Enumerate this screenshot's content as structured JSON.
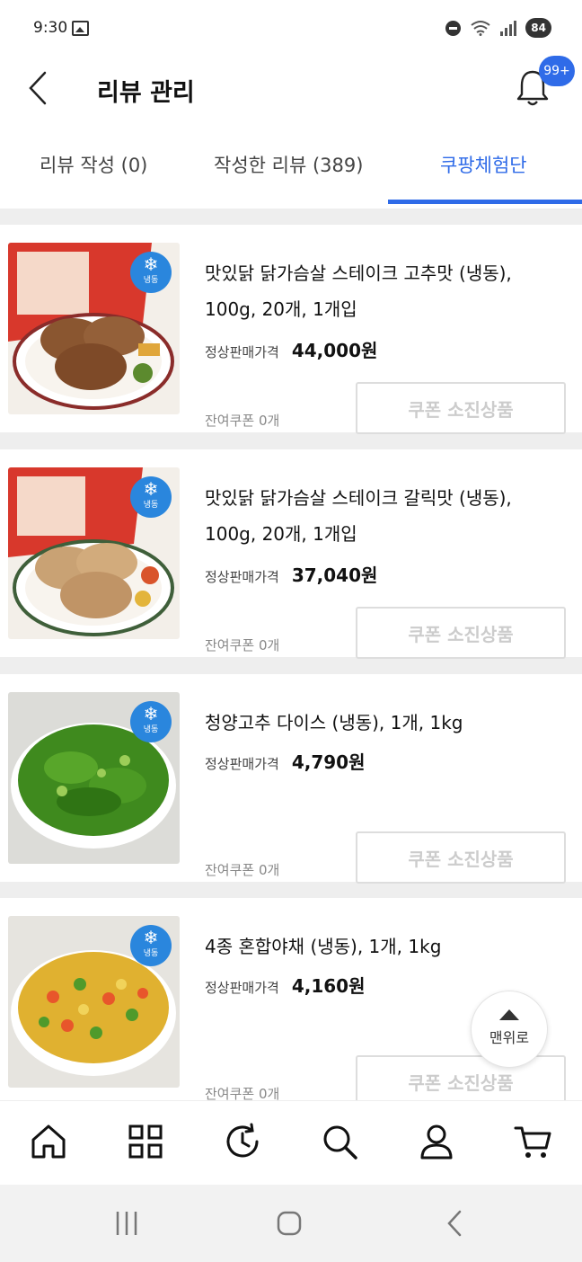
{
  "status_bar": {
    "time": "9:30",
    "battery": "84"
  },
  "header": {
    "title": "리뷰 관리",
    "notification_badge": "99+"
  },
  "tabs": [
    {
      "label": "리뷰 작성 (0)"
    },
    {
      "label": "작성한 리뷰 (389)"
    },
    {
      "label": "쿠팡체험단",
      "active": true
    }
  ],
  "products": [
    {
      "name": "맛있닭 닭가슴살 스테이크 고추맛 (냉동), 100g, 20개, 1개입",
      "price_label": "정상판매가격",
      "price": "44,000원",
      "frozen_label": "냉동",
      "coupon_remaining": "잔여쿠폰 0개",
      "button_label": "쿠폰 소진상품"
    },
    {
      "name": "맛있닭 닭가슴살 스테이크 갈릭맛 (냉동), 100g, 20개, 1개입",
      "price_label": "정상판매가격",
      "price": "37,040원",
      "frozen_label": "냉동",
      "coupon_remaining": "잔여쿠폰 0개",
      "button_label": "쿠폰 소진상품"
    },
    {
      "name": "청양고추 다이스 (냉동), 1개, 1kg",
      "price_label": "정상판매가격",
      "price": "4,790원",
      "frozen_label": "냉동",
      "coupon_remaining": "잔여쿠폰 0개",
      "button_label": "쿠폰 소진상품"
    },
    {
      "name": "4종 혼합야채 (냉동), 1개, 1kg",
      "price_label": "정상판매가격",
      "price": "4,160원",
      "frozen_label": "냉동",
      "coupon_remaining": "잔여쿠폰 0개",
      "button_label": "쿠폰 소진상품"
    }
  ],
  "top_button": {
    "label": "맨위로"
  },
  "bottom_nav": [
    {
      "icon": "home-icon"
    },
    {
      "icon": "category-icon"
    },
    {
      "icon": "history-icon"
    },
    {
      "icon": "search-icon"
    },
    {
      "icon": "user-icon"
    },
    {
      "icon": "cart-icon"
    }
  ],
  "colors": {
    "accent": "#2f6be8",
    "frozen_badge": "#2a86dd",
    "divider": "#eeeeee"
  }
}
